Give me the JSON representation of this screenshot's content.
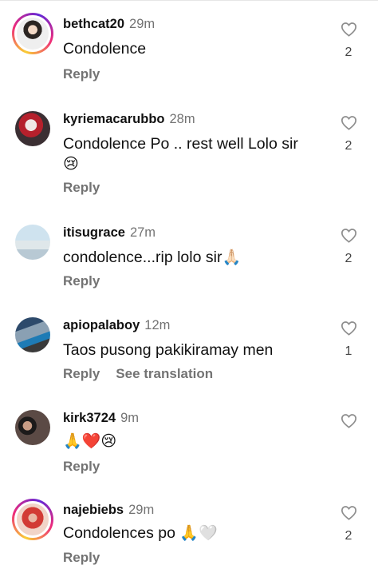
{
  "comments": [
    {
      "username": "bethcat20",
      "time": "29m",
      "text": "Condolence",
      "emoji": "",
      "likes": "2",
      "actions": [
        "Reply"
      ]
    },
    {
      "username": "kyriemacarubbo",
      "time": "28m",
      "text": "Condolence Po .. rest well Lolo sir",
      "emoji": "😢",
      "likes": "2",
      "actions": [
        "Reply"
      ]
    },
    {
      "username": "itisugrace",
      "time": "27m",
      "text": "condolence...rip lolo sir",
      "emoji": "🙏🏻",
      "likes": "2",
      "actions": [
        "Reply"
      ]
    },
    {
      "username": "apiopalaboy",
      "time": "12m",
      "text": "Taos pusong pakikiramay men",
      "emoji": "",
      "likes": "1",
      "actions": [
        "Reply",
        "See translation"
      ]
    },
    {
      "username": "kirk3724",
      "time": "9m",
      "text": "",
      "emoji": "🙏❤️😢",
      "likes": "",
      "actions": [
        "Reply"
      ]
    },
    {
      "username": "najebiebs",
      "time": "29m",
      "text": "Condolences po ",
      "emoji": "🙏🤍",
      "likes": "2",
      "actions": [
        "Reply"
      ]
    }
  ],
  "icons": {
    "like": "heart-outline-icon"
  },
  "colors": {
    "meta": "#737373",
    "text": "#111111",
    "story_ring": "#ee2a7b"
  }
}
